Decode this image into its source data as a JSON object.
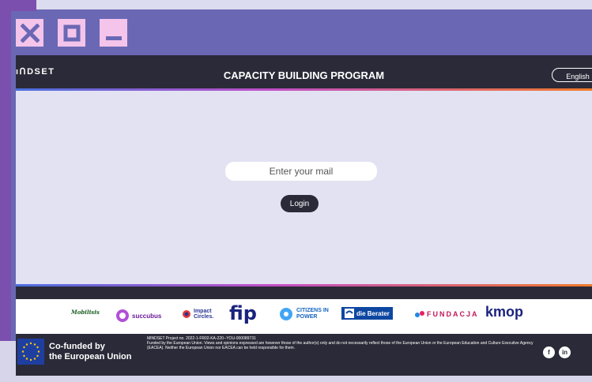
{
  "window": {
    "controls": [
      {
        "icon": "close-icon"
      },
      {
        "icon": "maximize-icon"
      },
      {
        "icon": "minimize-icon"
      }
    ]
  },
  "header": {
    "brand": "ıᑎDSET",
    "title": "CAPACITY BUILDING PROGRAM",
    "language": "English"
  },
  "login": {
    "email_placeholder": "Enter your mail",
    "login_label": "Login"
  },
  "partners": [
    {
      "name": "Mobilisis",
      "color": "#1b5e20"
    },
    {
      "name": "succubus",
      "color": "#6a1b9a"
    },
    {
      "name": "Impact Circles.",
      "color": "#283593"
    },
    {
      "name": "fip",
      "color": "#1a237e"
    },
    {
      "name": "CITIZENS IN POWER",
      "color": "#1565c0"
    },
    {
      "name": "die Berater",
      "color": "#0d47a1"
    },
    {
      "name": "FUNDACJA",
      "color": "#c2185b"
    },
    {
      "name": "kmop",
      "color": "#1a237e"
    }
  ],
  "footer": {
    "eu_line1": "Co-funded by",
    "eu_line2": "the European Union",
    "project_no": "MINDSET Project no. 2022-1-FR02-KA-220--YOU-000089731",
    "disclaimer": "Funded by the European Union. Views and opinions expressed are however those of the author(s) only and do not necessarily reflect those of the European Union or the European Education and Culture Executive Agency (EACEA). Neither the European Union nor EACEA can be held responsible for them.",
    "social": [
      "facebook-icon",
      "linkedin-icon"
    ]
  },
  "colors": {
    "background": "#6a68b4",
    "window_button": "#f4c4ea",
    "header": "#2b2a38",
    "accent_gradient_start": "#4a6fe0",
    "accent_gradient_end": "#f07a2a"
  }
}
